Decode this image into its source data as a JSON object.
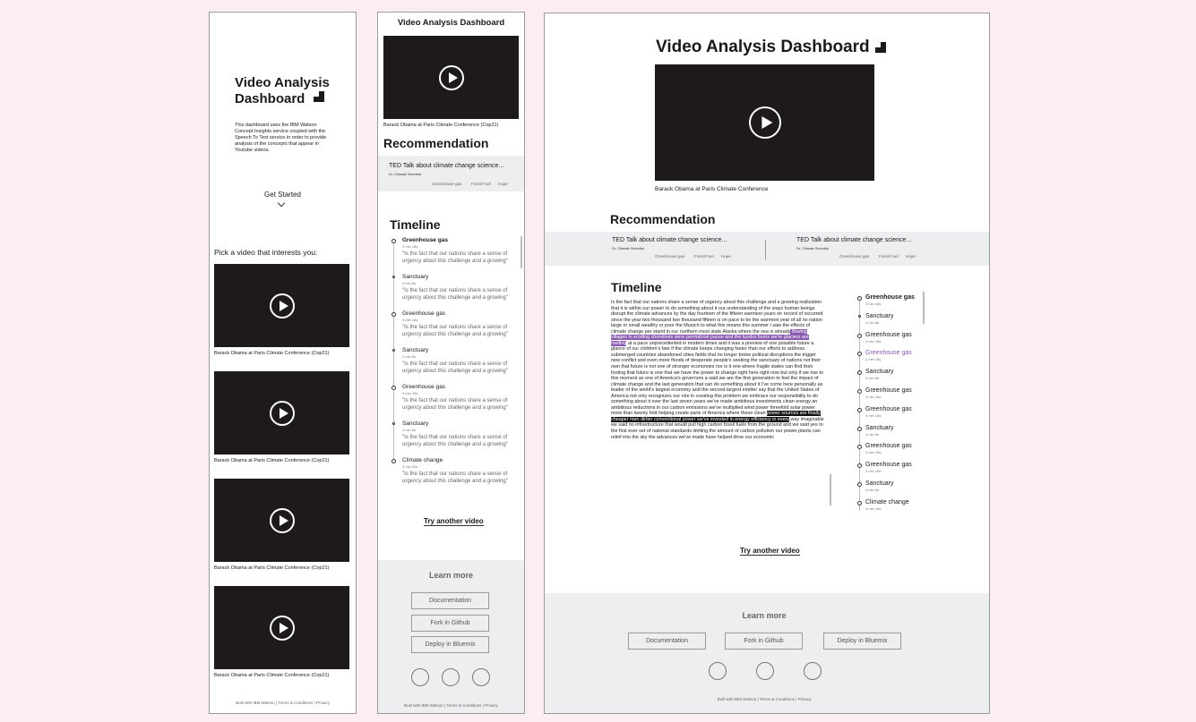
{
  "title": "Video Analysis Dashboard",
  "title_line1": "Video Analysis",
  "title_line2": "Dashboard",
  "intro": "This dashboard uses the IBM Watson Concept Insights service coupled with the Speech To Text service in order to provide analysis of the concepts that appear in Youtube videos.",
  "get_started": "Get Started",
  "pick_video": "Pick a video that interests you:",
  "video_caption": "Barack Obama at Paris Climate Conference (Cop21)",
  "video_caption_short": "Barack Obama at Paris Climate Conference",
  "recommendation_title": "Recommendation",
  "rec_card": {
    "title": "TED Talk about climate change science...",
    "author": "Dr. Climate Scientist",
    "tags": [
      "Greenhouse gas",
      "Fossil Fuel",
      "Hope"
    ]
  },
  "timeline_title": "Timeline",
  "timeline_mobile": [
    {
      "label": "Greenhouse gas",
      "time": "3 min 18s",
      "quote": "\"Is the fact that our nations share a sense of urgency about this challenge and a growing\""
    },
    {
      "label": "Sanctuary",
      "time": "4 min 8s",
      "quote": "\"Is the fact that our nations share a sense of urgency about this challenge and a growing\""
    },
    {
      "label": "Greenhouse gas",
      "time": "3 min 18s",
      "quote": "\"Is the fact that our nations share a sense of urgency about this challenge and a growing\""
    },
    {
      "label": "Sanctuary",
      "time": "4 min 8s",
      "quote": "\"Is the fact that our nations share a sense of urgency about this challenge and a growing\""
    },
    {
      "label": "Greenhouse gas",
      "time": "3 min 18s",
      "quote": "\"Is the fact that our nations share a sense of urgency about this challenge and a growing\""
    },
    {
      "label": "Sanctuary",
      "time": "4 min 8s",
      "quote": "\"Is the fact that our nations share a sense of urgency about this challenge and a growing\""
    },
    {
      "label": "Climate change",
      "time": "3 min 20s",
      "quote": "\"Is the fact that our nations share a sense of urgency about this challenge and a growing\""
    }
  ],
  "timeline_desktop": [
    {
      "label": "Greenhouse gas",
      "time": "3 min 18s"
    },
    {
      "label": "Sanctuary",
      "time": "4 min 8s"
    },
    {
      "label": "Greenhouse gas",
      "time": "3 min 18s"
    },
    {
      "label": "Greenhouse gas",
      "time": "3 min 18s"
    },
    {
      "label": "Sanctuary",
      "time": "4 min 8s"
    },
    {
      "label": "Greenhouse gas",
      "time": "3 min 18s"
    },
    {
      "label": "Greenhouse gas",
      "time": "3 min 18s"
    },
    {
      "label": "Sanctuary",
      "time": "4 min 8s"
    },
    {
      "label": "Greenhouse gas",
      "time": "3 min 18s"
    },
    {
      "label": "Greenhouse gas",
      "time": "3 min 18s"
    },
    {
      "label": "Sanctuary",
      "time": "4 min 8s"
    },
    {
      "label": "Climate change",
      "time": "3 min 18s"
    }
  ],
  "transcript": {
    "part1": "Is the fact that our nations share a sense of urgency about this challenge and a growing realization that it is within our power to do something about it our understanding of the ways human beings disrupt the climate advances by the day fourteen of the fifteen warmest years on record of occurred since the year two thousand two thousand fifteen is on pace to be the warmest year of all no nation large or small wealthy or poor the Munich to what this means this summer I saw the effects of climate change per stand in our northern most state Alaska where the sea is already",
    "highlight1": " flowing villages in eroding shorelines were permafrost pause and the tundra burns we're glaciers are melting",
    "part2": " at a pace unprecedented in modern times and it was a preview of one possible future a glance of our children's fate if the climate keeps changing faster than our efforts to address submerged countries abandoned cities fields that no longer broke political disruptions the trigger new conflict and even more floods of desperate people's seeking the sanctuary of nations not their own that future is not one of stronger economies nor is it one where fragile states can find their footing that future is one that we have the power to change right here right now but only if we rise to this moment as one of America's governors a said we are the first generation to feel the impact of climate change and the last generation that can do something about it I've come here personally as leader of the world's largest economy and the second largest emitter say that the United States of America not only recognizes our role in creating this problem we embrace our responsibility to do something about it over the last seven years we've made ambitious investments clean energy an ambitious reductions in our carbon emissions we've multiplied wind power threefold solar power more than twenty fold helping create parts of America where these clean ",
    "highlight2": "power sources are finally cheaper men dirtier conventional power we've invested in energy efficiency in every",
    "part3": " way imaginable we said no infrastructure that would pull high carbon fossil fuels from the ground and we said yes to the first ever set of national standards limiting the amount of carbon pollution our power plants can relief into the sky the advances we've made have helped drive our economic"
  },
  "try_another": "Try another video",
  "learn_more": "Learn more",
  "buttons": {
    "docs": "Documentation",
    "fork": "Fork in Github",
    "deploy": "Deploy in Bluemix"
  },
  "footer": {
    "built": "Built with IBM Watson",
    "terms": "Terms & Conditions",
    "privacy": "Privacy",
    "sep": "|"
  },
  "icons": {
    "play": "play-icon",
    "logo": "dashboard-logo-icon",
    "chevron": "chevron-down-icon"
  },
  "colors": {
    "background": "#fcedf1",
    "video": "#1e1a1b",
    "highlight": "#8a5bb0",
    "panel": "#eceeef"
  }
}
